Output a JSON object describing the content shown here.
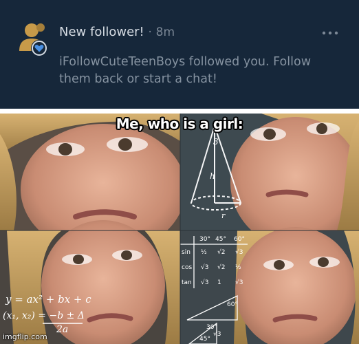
{
  "notification": {
    "title": "New follower!",
    "separator": "·",
    "time": "8m",
    "body": "iFollowCuteTeenBoys followed you. Follow them back or start a chat!",
    "more_icon": "ellipsis-icon",
    "avatar_icon": "user-avatar-icon",
    "badge_icon": "heart-badge-icon",
    "colors": {
      "background": "#16273a",
      "title": "#d7dde4",
      "muted": "#8592a0",
      "accent": "#4a90e2"
    }
  },
  "meme": {
    "caption": "Me, who is a girl:",
    "watermark": "imgflip.com"
  }
}
